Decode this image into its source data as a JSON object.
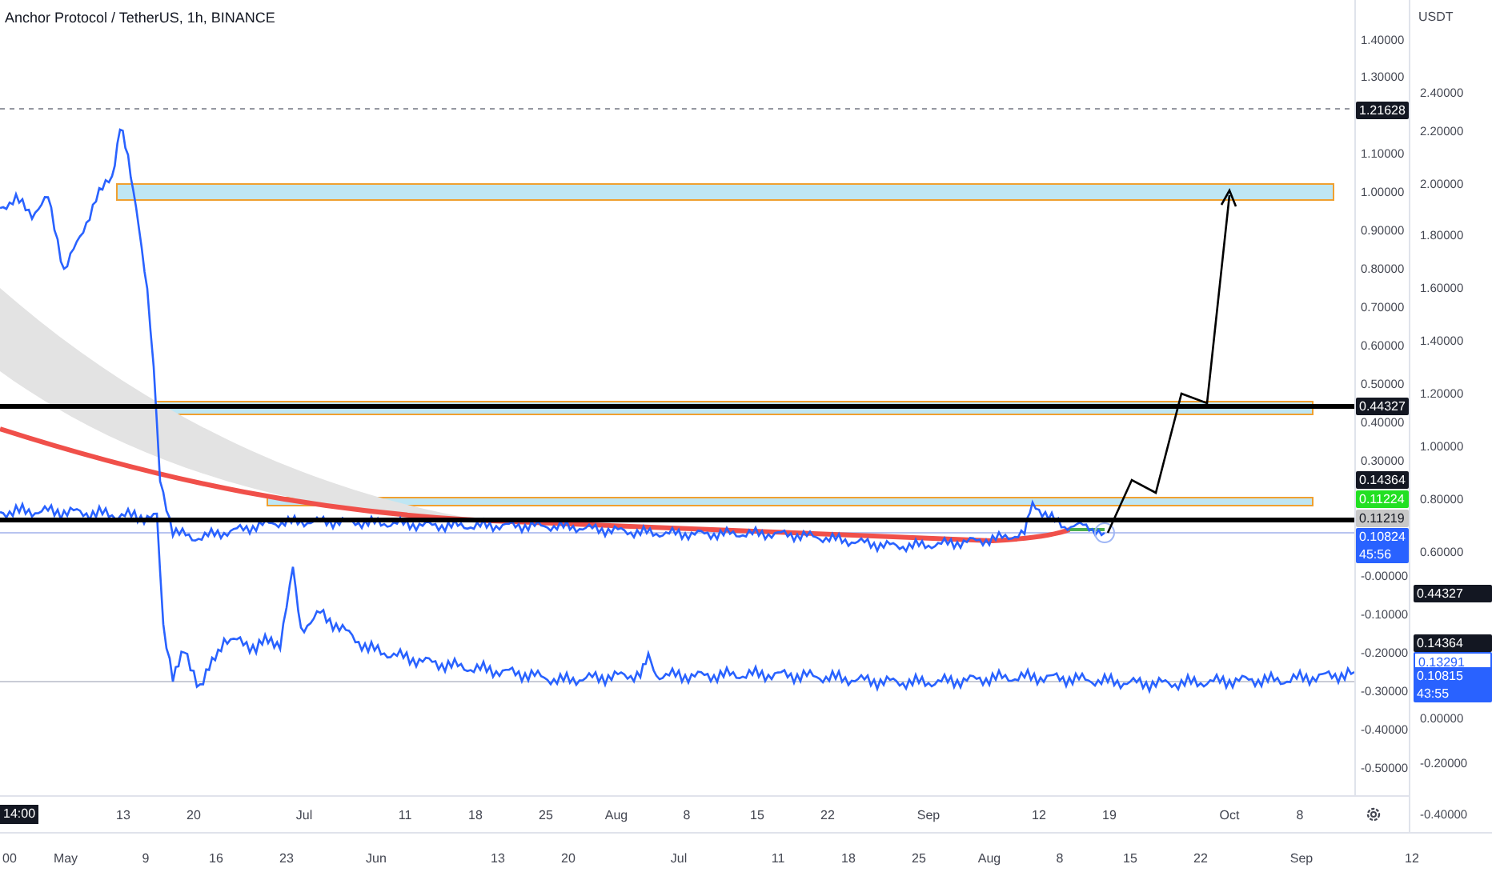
{
  "title": "Anchor Protocol / TetherUS, 1h, BINANCE",
  "inner_price_axis": {
    "ticks": [
      "1.40000",
      "1.30000",
      "1.10000",
      "1.00000",
      "0.90000",
      "0.80000",
      "0.70000",
      "0.60000",
      "0.50000",
      "0.40000",
      "0.30000",
      "-0.00000",
      "-0.10000",
      "-0.20000",
      "-0.30000",
      "-0.40000",
      "-0.50000"
    ],
    "badges": [
      {
        "text": "1.21628",
        "kind": "filled",
        "color": "#131722"
      },
      {
        "text": "0.44327",
        "kind": "filled",
        "color": "#131722"
      },
      {
        "text": "0.14364",
        "kind": "filled",
        "color": "#131722"
      },
      {
        "text": "0.11224",
        "kind": "filled",
        "color": "#22e022"
      },
      {
        "text": "0.11219",
        "kind": "filled",
        "color": "#c8c8c8"
      },
      {
        "text": "0.10824",
        "subtext": "45:56",
        "kind": "filled",
        "color": "#2962ff"
      }
    ]
  },
  "outer_price_axis": {
    "unit": "USDT",
    "ticks": [
      "2.40000",
      "2.20000",
      "2.00000",
      "1.80000",
      "1.60000",
      "1.40000",
      "1.20000",
      "1.00000",
      "0.80000",
      "0.60000",
      "0.00000",
      "-0.20000",
      "-0.40000"
    ],
    "badges": [
      {
        "text": "0.44327",
        "kind": "filled",
        "color": "#131722"
      },
      {
        "text": "0.14364",
        "kind": "filled",
        "color": "#131722"
      },
      {
        "text": "0.13291",
        "kind": "outlined",
        "color": "#2962ff"
      },
      {
        "text": "0.10815",
        "subtext": "43:55",
        "kind": "filled",
        "color": "#2962ff"
      }
    ]
  },
  "inner_time_axis": {
    "cursor_label": "14:00",
    "labels": [
      "13",
      "20",
      "Jul",
      "11",
      "18",
      "25",
      "Aug",
      "8",
      "15",
      "22",
      "Sep",
      "12",
      "19",
      "Oct",
      "8"
    ]
  },
  "outer_time_axis": {
    "labels": [
      "00",
      "May",
      "9",
      "16",
      "23",
      "Jun",
      "13",
      "20",
      "Jul",
      "11",
      "18",
      "25",
      "Aug",
      "8",
      "15",
      "22",
      "Sep",
      "12"
    ]
  }
}
